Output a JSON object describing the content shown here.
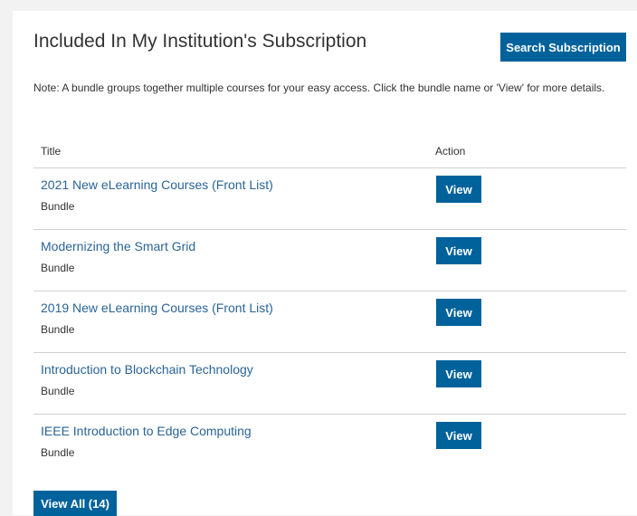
{
  "header": {
    "title": "Included In My Institution's Subscription",
    "search_label": "Search Subscription"
  },
  "note": "Note: A bundle groups together multiple courses for your easy access. Click the bundle name or 'View' for more details.",
  "table": {
    "columns": {
      "title": "Title",
      "action": "Action"
    },
    "rows": [
      {
        "title": "2021 New eLearning Courses (Front List)",
        "type": "Bundle",
        "action": "View"
      },
      {
        "title": "Modernizing the Smart Grid",
        "type": "Bundle",
        "action": "View"
      },
      {
        "title": "2019 New eLearning Courses (Front List)",
        "type": "Bundle",
        "action": "View"
      },
      {
        "title": "Introduction to Blockchain Technology",
        "type": "Bundle",
        "action": "View"
      },
      {
        "title": "IEEE Introduction to Edge Computing",
        "type": "Bundle",
        "action": "View"
      }
    ]
  },
  "footer": {
    "view_all_label": "View All (14)"
  },
  "colors": {
    "button_bg": "#00629b",
    "link": "#2a6496",
    "divider": "#d0d0d0"
  }
}
